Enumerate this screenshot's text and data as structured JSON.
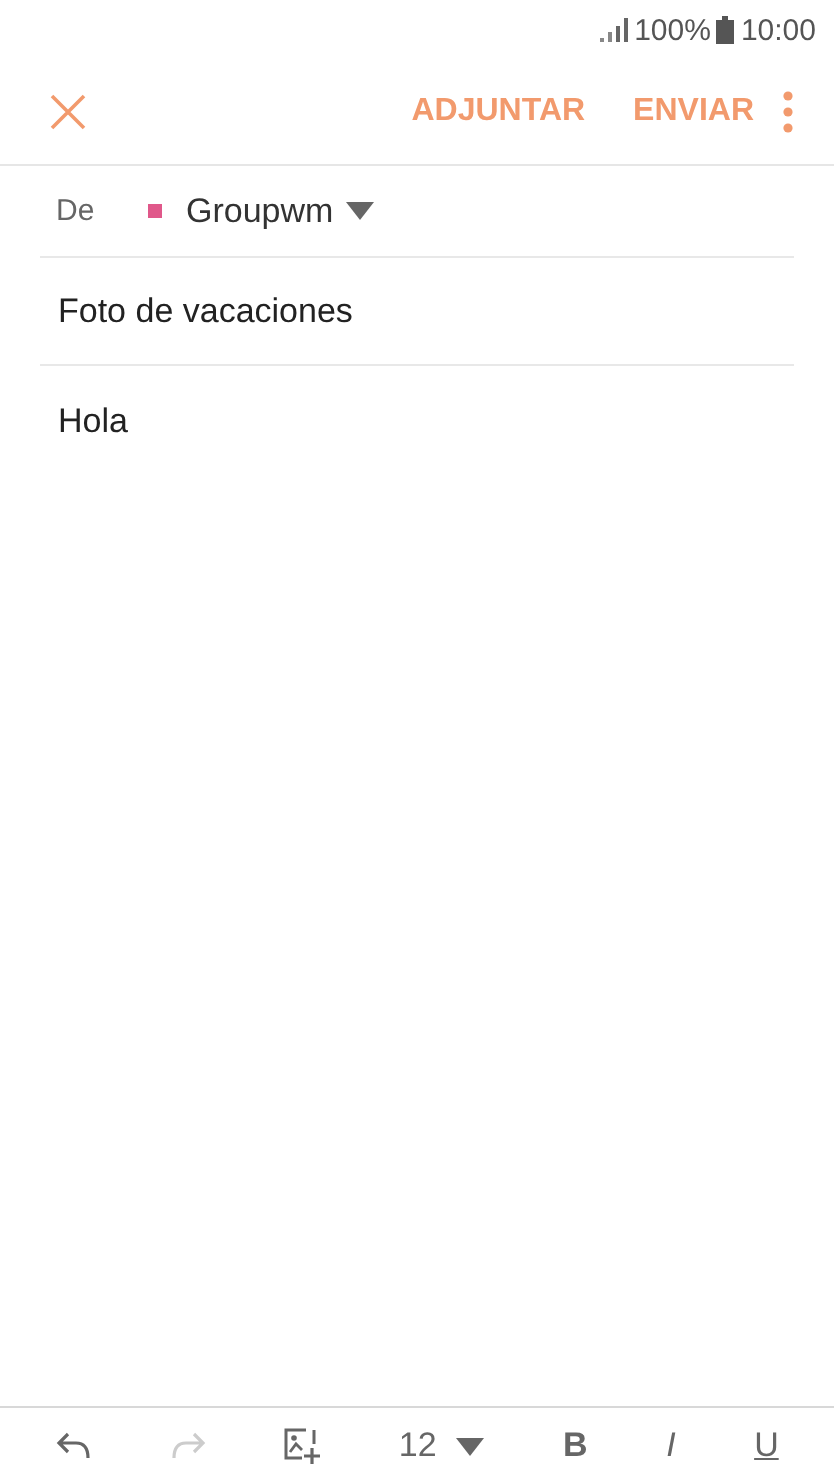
{
  "status_bar": {
    "battery": "100%",
    "time": "10:00"
  },
  "app_bar": {
    "actions": [
      "ADJUNTAR",
      "ENVIAR"
    ]
  },
  "from": {
    "label": "De",
    "account": "Groupwm",
    "color": "#e0588a"
  },
  "subject": {
    "value": "Foto de vacaciones"
  },
  "body": {
    "value": "Hola"
  },
  "format_bar": [
    {
      "kind": "undo",
      "disabled": false
    },
    {
      "kind": "redo",
      "disabled": true
    },
    {
      "kind": "image",
      "disabled": false
    },
    {
      "kind": "size",
      "label": "12",
      "disabled": false
    },
    {
      "kind": "text",
      "label": "B",
      "disabled": false
    },
    {
      "kind": "text",
      "label": "I",
      "disabled": false
    },
    {
      "kind": "text",
      "label": "U",
      "disabled": false
    }
  ]
}
